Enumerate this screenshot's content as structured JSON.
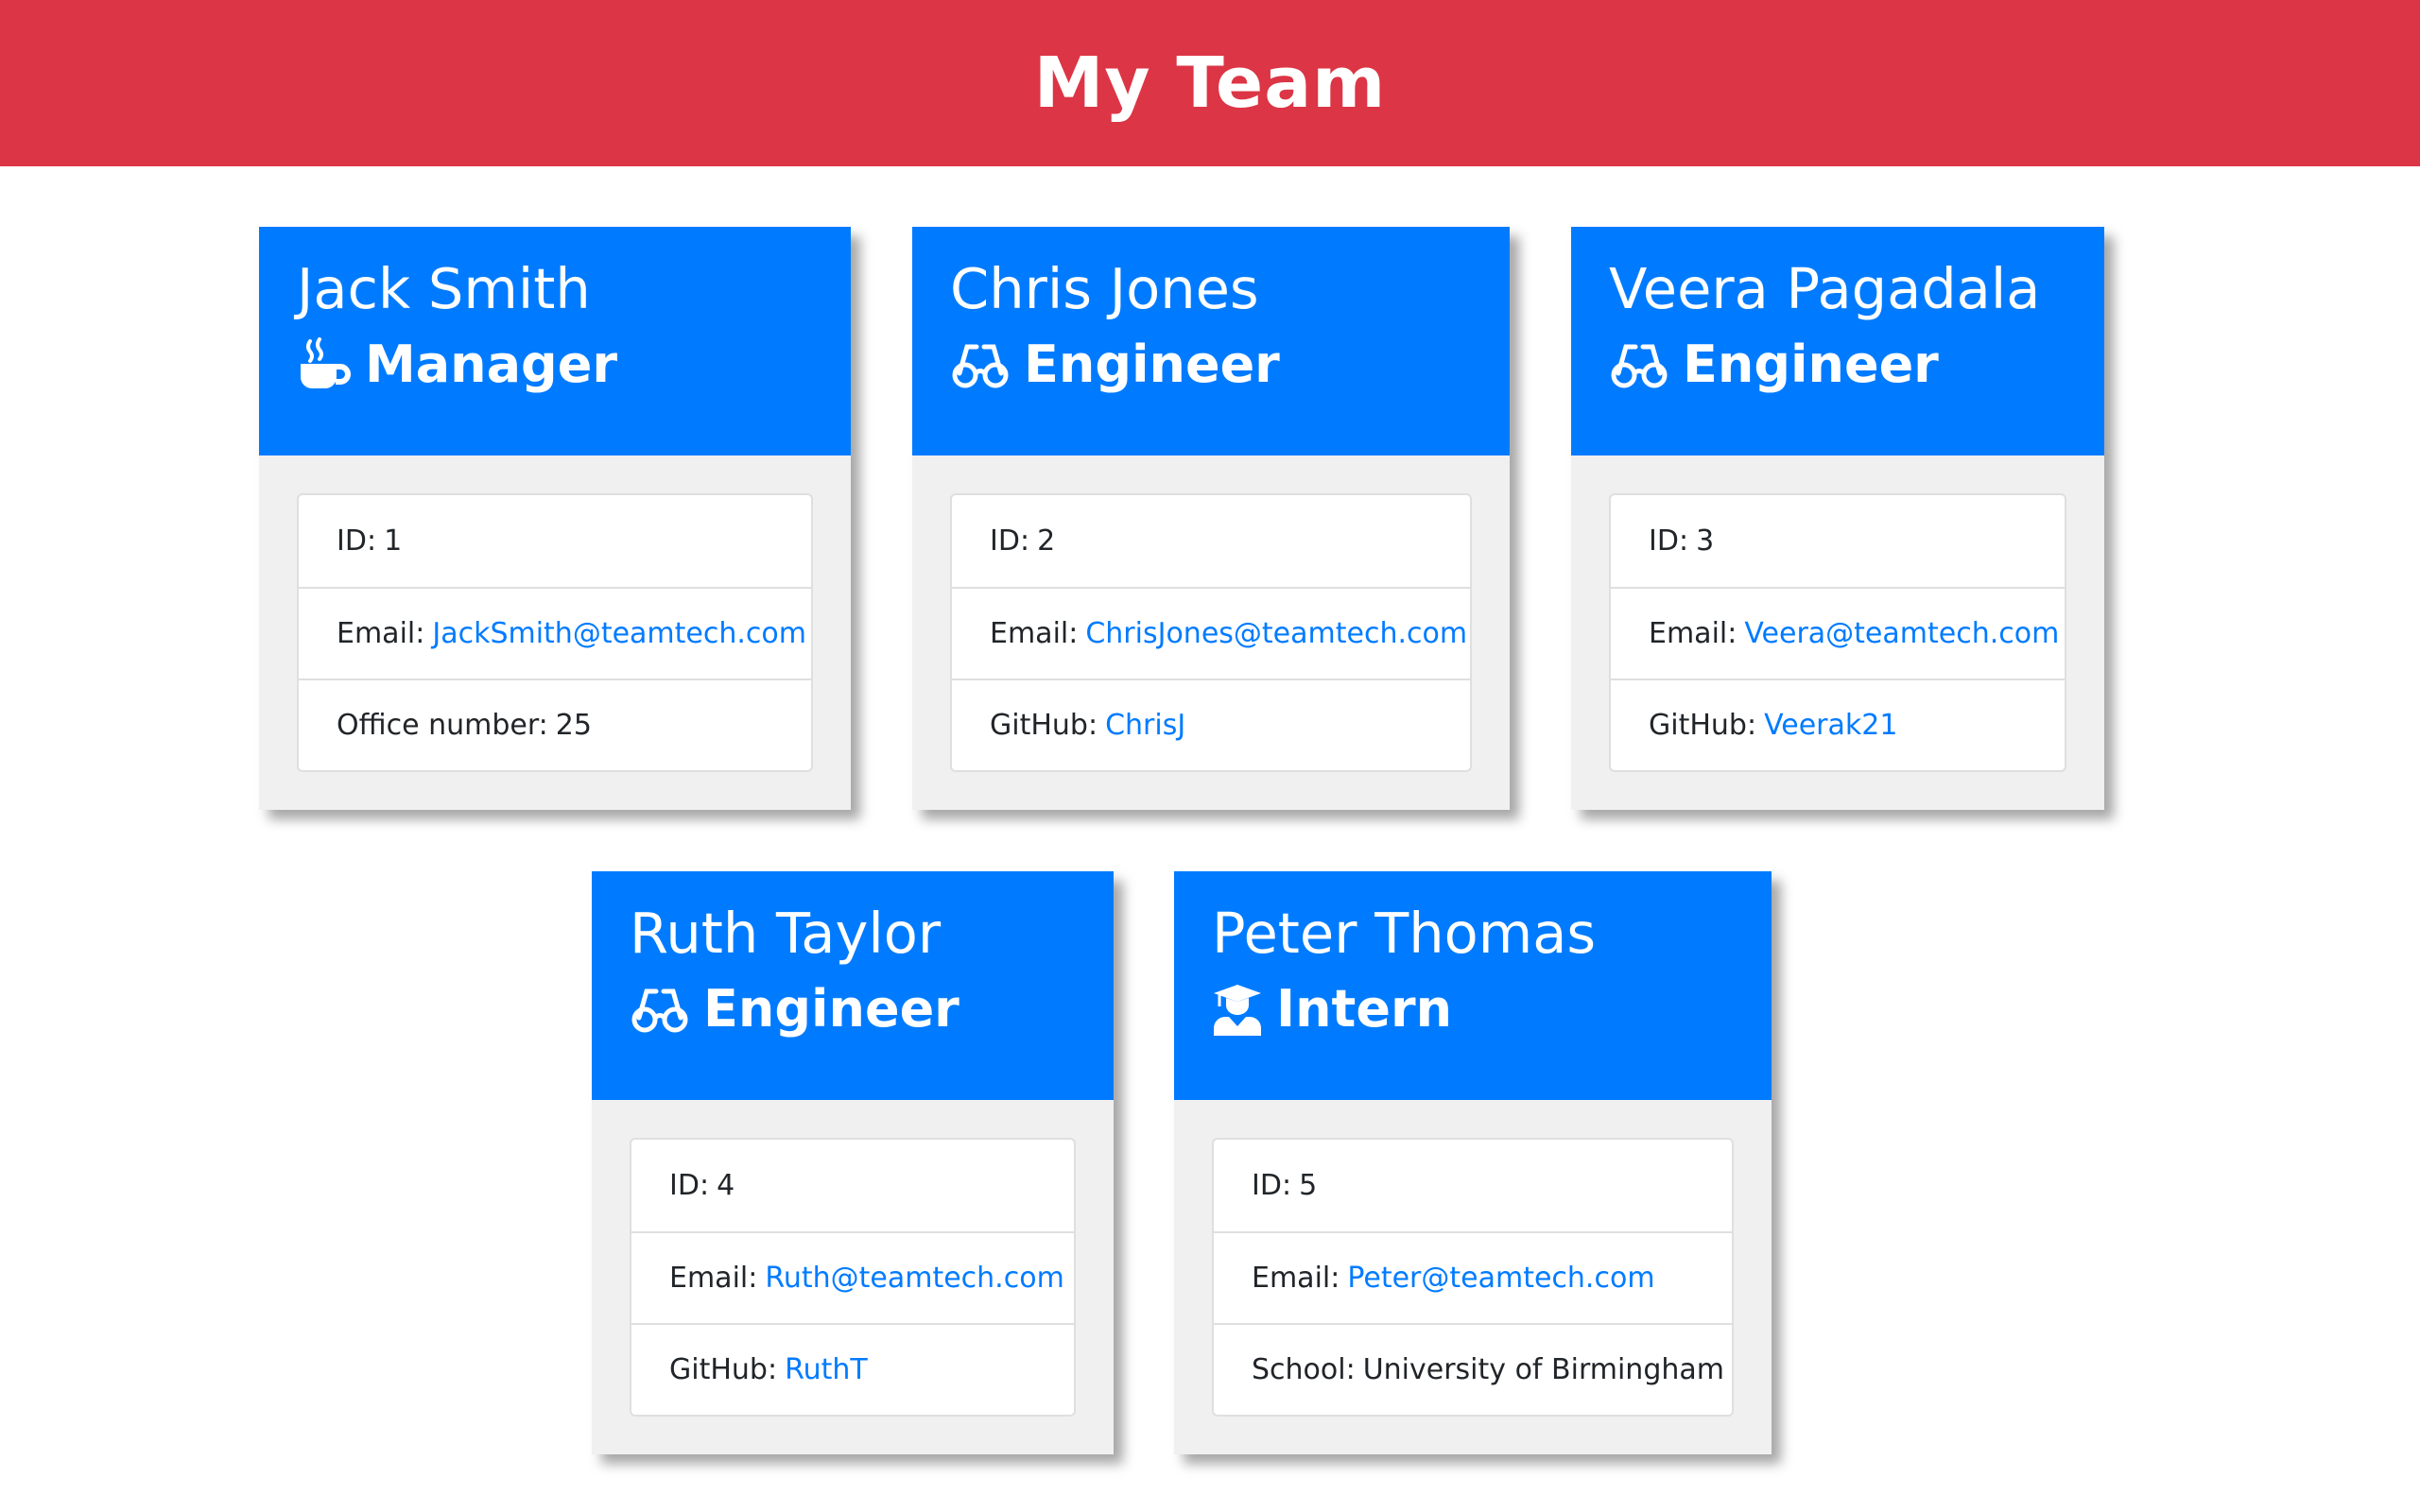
{
  "header": {
    "title": "My Team"
  },
  "employees": [
    {
      "name": "Jack Smith",
      "role": "Manager",
      "icon": "coffee-icon",
      "id_label": "ID:",
      "id": "1",
      "email_label": "Email:",
      "email": "JackSmith@teamtech.com",
      "extra_label": "Office number:",
      "extra": "25"
    },
    {
      "name": "Chris Jones",
      "role": "Engineer",
      "icon": "glasses-icon",
      "id_label": "ID:",
      "id": "2",
      "email_label": "Email:",
      "email": "ChrisJones@teamtech.com",
      "extra_label": "GitHub:",
      "extra": "ChrisJ"
    },
    {
      "name": "Veera Pagadala",
      "role": "Engineer",
      "icon": "glasses-icon",
      "id_label": "ID:",
      "id": "3",
      "email_label": "Email:",
      "email": "Veera@teamtech.com",
      "extra_label": "GitHub:",
      "extra": "Veerak21"
    },
    {
      "name": "Ruth Taylor",
      "role": "Engineer",
      "icon": "glasses-icon",
      "id_label": "ID:",
      "id": "4",
      "email_label": "Email:",
      "email": "Ruth@teamtech.com",
      "extra_label": "GitHub:",
      "extra": "RuthT"
    },
    {
      "name": "Peter Thomas",
      "role": "Intern",
      "icon": "graduate-icon",
      "id_label": "ID:",
      "id": "5",
      "email_label": "Email:",
      "email": "Peter@teamtech.com",
      "extra_label": "School:",
      "extra": "University of Birmingham"
    }
  ],
  "colors": {
    "header_bg": "#dc3545",
    "card_header_bg": "#007bff",
    "link": "#007bff",
    "card_body_bg": "#f0f0f0"
  }
}
